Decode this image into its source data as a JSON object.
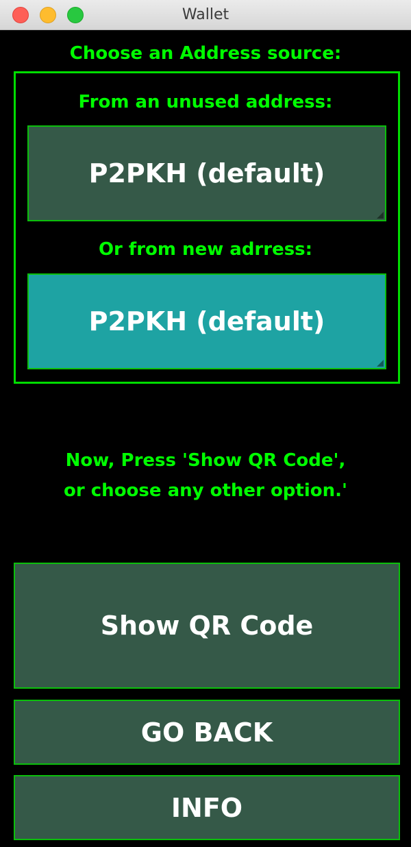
{
  "window": {
    "title": "Wallet"
  },
  "address_source": {
    "heading": "Choose an Address source:",
    "unused_label": "From an unused address:",
    "unused_button": "P2PKH (default)",
    "new_label": "Or from new adrress:",
    "new_button": "P2PKH (default)"
  },
  "instructions": {
    "line1": "Now, Press 'Show QR Code',",
    "line2": "or choose any other option.'"
  },
  "actions": {
    "show_qr": "Show QR Code",
    "go_back": "GO BACK",
    "info": "INFO"
  },
  "colors": {
    "text_accent": "#00ff00",
    "button_dark": "#355948",
    "button_selected": "#1ea3a3",
    "border": "#00dd00"
  }
}
